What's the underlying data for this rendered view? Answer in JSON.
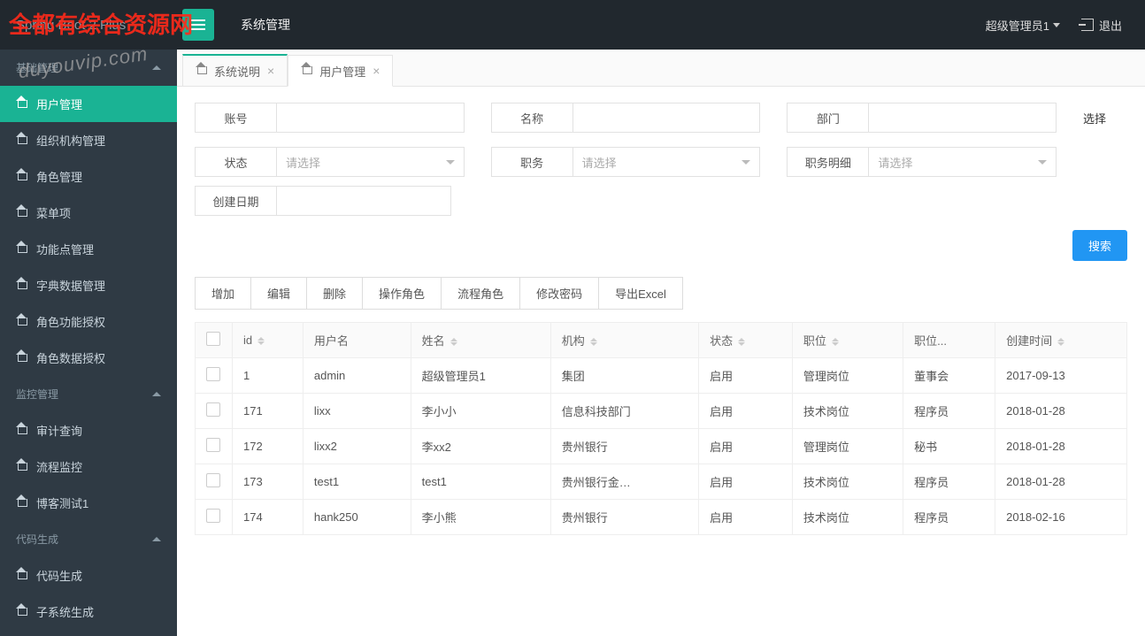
{
  "brand": "Spring Boot 2 Plus",
  "watermark_text": "全都有综合资源网",
  "watermark_url": "duyouvip.com",
  "header": {
    "module_title": "系统管理",
    "user": "超级管理员1",
    "logout": "退出"
  },
  "sidebar": {
    "groups": [
      {
        "label": "基础管理",
        "items": [
          "用户管理",
          "组织机构管理",
          "角色管理",
          "菜单项",
          "功能点管理",
          "字典数据管理",
          "角色功能授权",
          "角色数据授权"
        ]
      },
      {
        "label": "监控管理",
        "items": [
          "审计查询",
          "流程监控",
          "博客测试1"
        ]
      },
      {
        "label": "代码生成",
        "items": [
          "代码生成",
          "子系统生成"
        ]
      }
    ],
    "active": "用户管理"
  },
  "tabs": [
    {
      "label": "系统说明",
      "active": false
    },
    {
      "label": "用户管理",
      "active": true
    }
  ],
  "search": {
    "fields": {
      "account": "账号",
      "name": "名称",
      "dept": "部门",
      "status": "状态",
      "job": "职务",
      "job_detail": "职务明细",
      "create_date": "创建日期"
    },
    "placeholder_select": "请选择",
    "choose_link": "选择",
    "btn": "搜索"
  },
  "toolbar": [
    "增加",
    "编辑",
    "删除",
    "操作角色",
    "流程角色",
    "修改密码",
    "导出Excel"
  ],
  "table": {
    "columns": [
      "id",
      "用户名",
      "姓名",
      "机构",
      "状态",
      "职位",
      "职位...",
      "创建时间"
    ],
    "rows": [
      {
        "id": "1",
        "user": "admin",
        "name": "超级管理员1",
        "org": "集团",
        "status": "启用",
        "pos": "管理岗位",
        "posd": "董事会",
        "ct": "2017-09-13"
      },
      {
        "id": "171",
        "user": "lixx",
        "name": "李小小",
        "org": "信息科技部门",
        "status": "启用",
        "pos": "技术岗位",
        "posd": "程序员",
        "ct": "2018-01-28"
      },
      {
        "id": "172",
        "user": "lixx2",
        "name": "李xx2",
        "org": "贵州银行",
        "status": "启用",
        "pos": "管理岗位",
        "posd": "秘书",
        "ct": "2018-01-28"
      },
      {
        "id": "173",
        "user": "test1",
        "name": "test1",
        "org": "贵州银行金…",
        "status": "启用",
        "pos": "技术岗位",
        "posd": "程序员",
        "ct": "2018-01-28"
      },
      {
        "id": "174",
        "user": "hank250",
        "name": "李小熊",
        "org": "贵州银行",
        "status": "启用",
        "pos": "技术岗位",
        "posd": "程序员",
        "ct": "2018-02-16"
      }
    ]
  }
}
